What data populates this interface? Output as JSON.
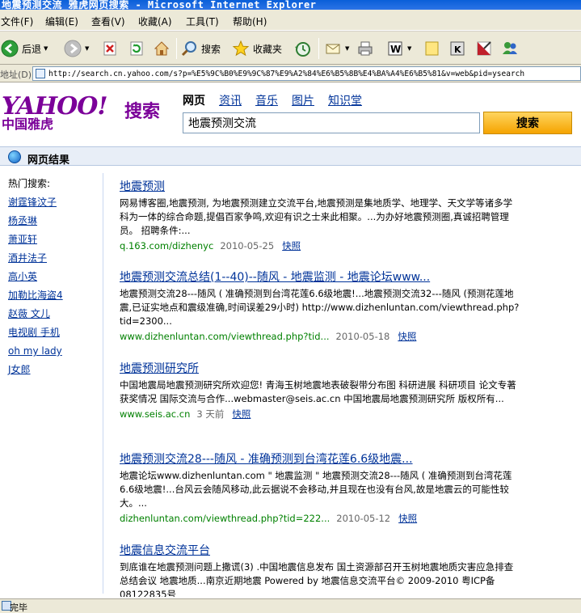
{
  "window": {
    "title": "地震预测交流_雅虎网页搜索 - Microsoft Internet Explorer"
  },
  "menu": [
    "文件(F)",
    "编辑(E)",
    "查看(V)",
    "收藏(A)",
    "工具(T)",
    "帮助(H)"
  ],
  "toolbar": {
    "back_label": "后退",
    "search_label": "搜索",
    "favorites_label": "收藏夹"
  },
  "address": {
    "label": "地址(D)",
    "url": "http://search.cn.yahoo.com/s?p=%E5%9C%B0%E9%9C%87%E9%A2%84%E6%B5%8B%E4%BA%A4%E6%B5%81&v=web&pid=ysearch"
  },
  "yahoo": {
    "logo_top": "YAHOO!",
    "logo_cn": "中国雅虎",
    "logo_search": "搜索",
    "tabs": [
      "网页",
      "资讯",
      "音乐",
      "图片",
      "知识堂"
    ],
    "query": "地震预测交流",
    "search_button": "搜索"
  },
  "results_header": "网页结果",
  "sidebar": {
    "heading": "热门搜索:",
    "items": [
      "谢霆锋汶子",
      "杨丞琳",
      "萧亚轩",
      "酒井法子",
      "高小英",
      "加勒比海盗4",
      "赵薇 文儿",
      "电视剧 手机",
      "oh my lady",
      "J女郎"
    ]
  },
  "results": [
    {
      "title": "地震预测",
      "snippet": "网易博客圈,地震预测, 为地震预测建立交流平台,地震预测是集地质学、地理学、天文学等诸多学科为一体的综合命题,提倡百家争鸣,欢迎有识之士来此相聚。...为办好地震预测圈,真诚招聘管理员。 招聘条件:...",
      "url": "q.163.com/dizhenyc",
      "date": "2010-05-25",
      "cache": "快照"
    },
    {
      "title": "地震预测交流总结(1--40)--随风 - 地震监测 - 地震论坛www...",
      "snippet": "地震预测交流28---随风 ( 准确预测到台湾花莲6.6级地震!...地震预测交流32---随风 (预测花莲地震,已证实地点和震级准确,时间误差29小时) http://www.dizhenluntan.com/viewthread.php?tid=2300...",
      "url": "www.dizhenluntan.com/viewthread.php?tid...",
      "date": "2010-05-18",
      "cache": "快照"
    },
    {
      "title": "地震预测研究所",
      "snippet": "中国地震局地震预测研究所欢迎您! 青海玉树地震地表破裂带分布图 科研进展 科研项目 论文专著 获奖情况 国际交流与合作...webmaster@seis.ac.cn 中国地震局地震预测研究所 版权所有...",
      "url": "www.seis.ac.cn",
      "date": "3 天前",
      "cache": "快照"
    },
    {
      "title": "地震预测交流28---随风 - 准确预测到台湾花莲6.6级地震...",
      "snippet": "地震论坛www.dizhenluntan.com \" 地震监测 \" 地震预测交流28---随风 ( 准确预测到台湾花莲6.6级地震!...台风云会随风移动,此云据说不会移动,并且现在也没有台风,故是地震云的可能性较大。...",
      "url": "dizhenluntan.com/viewthread.php?tid=222...",
      "date": "2010-05-12",
      "cache": "快照"
    },
    {
      "title": "地震信息交流平台",
      "snippet": "到底谁在地震预测问题上撒谎(3) .中国地震信息发布 国土资源部召开玉树地震地质灾害应急排查总结会议 地震地质...南京近期地震 Powered by 地震信息交流平台© 2009-2010 粤ICP备08122835号",
      "url": "",
      "date": "",
      "cache": ""
    }
  ],
  "status": {
    "text": "完毕"
  }
}
